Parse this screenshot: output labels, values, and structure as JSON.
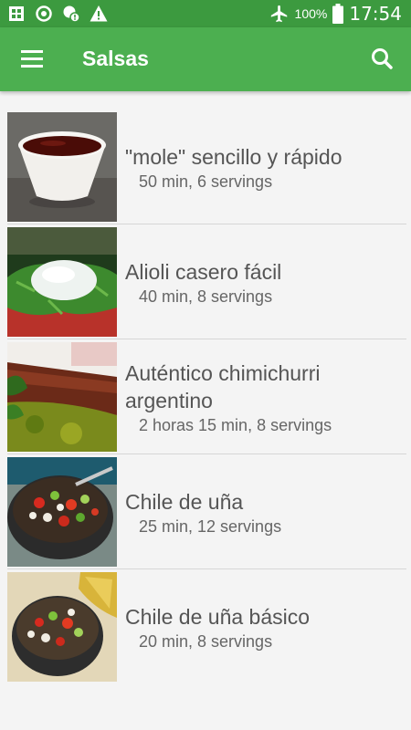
{
  "status_bar": {
    "battery_percent": "100%",
    "time": "17:54",
    "icons": [
      "sim-icon",
      "sync-icon",
      "app-icon",
      "warning-icon",
      "airplane-icon",
      "battery-icon"
    ]
  },
  "app_bar": {
    "title": "Salsas",
    "menu_icon": "hamburger-menu-icon",
    "search_icon": "search-icon"
  },
  "colors": {
    "primary": "#4caf50",
    "primary_dark": "#3c9a3f",
    "background": "#f4f4f4"
  },
  "recipes": [
    {
      "title": "\"mole\" sencillo y rápido",
      "meta": "50 min, 6 servings",
      "image": "mole-sauce-photo"
    },
    {
      "title": "Alioli casero fácil",
      "meta": "40 min, 8 servings",
      "image": "alioli-photo"
    },
    {
      "title": "Auténtico chimichurri argentino",
      "meta": "2 horas 15 min, 8 servings",
      "image": "chimichurri-photo"
    },
    {
      "title": "Chile de uña",
      "meta": "25 min, 12 servings",
      "image": "chile-de-una-photo"
    },
    {
      "title": "Chile de uña básico",
      "meta": "20 min, 8 servings",
      "image": "chile-de-una-basico-photo"
    }
  ]
}
